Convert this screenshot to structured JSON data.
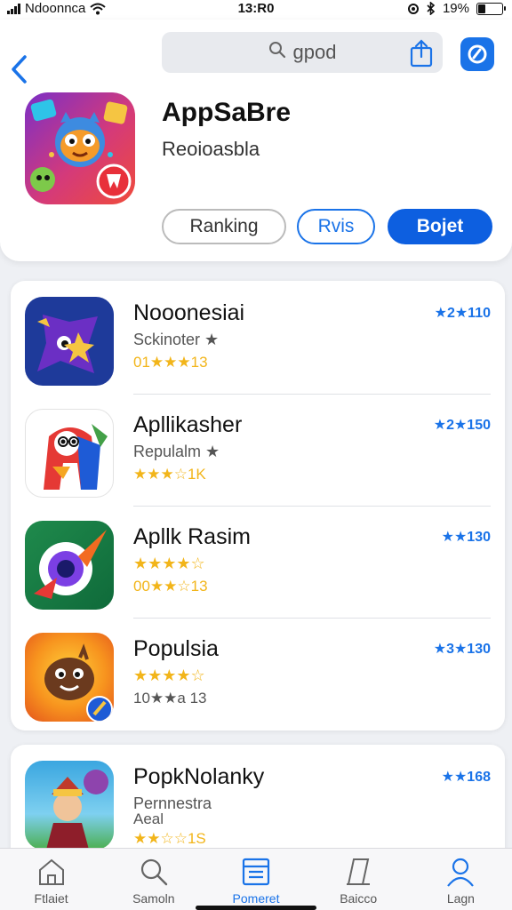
{
  "status_bar": {
    "carrier": "Ndoonnca",
    "time": "13:R0",
    "battery": "19%"
  },
  "header": {
    "search_text": "gpod",
    "app_title": "AppSaBre",
    "app_subtitle": "Reoioasbla",
    "buttons": {
      "ranking": "Ranking",
      "rvis": "Rvis",
      "get": "Bojet"
    }
  },
  "list": [
    {
      "name": "Nooonesiai",
      "subtitle": "Sckinoter ★",
      "meta": "01★★★13",
      "rank": "★2★110",
      "stars": null
    },
    {
      "name": "Apllikasher",
      "subtitle": "Repulalm ★",
      "meta": "★★★☆1K",
      "rank": "★2★150",
      "stars": null
    },
    {
      "name": "Apllk Rasim",
      "subtitle": "★★★★☆",
      "meta": "00★★☆13",
      "rank": "★★130",
      "stars": null
    },
    {
      "name": "Populsia",
      "subtitle": "★★★★☆",
      "meta": "10★★a 13",
      "rank": "★3★130",
      "stars": null
    }
  ],
  "list2": [
    {
      "name": "PopkNolanky",
      "subtitle": "Pernnestra",
      "subtitle2": "Aeal",
      "meta": "★★☆☆1S",
      "rank": "★★168"
    }
  ],
  "tabs": [
    {
      "label": "Ftlaiet",
      "icon": "home-icon"
    },
    {
      "label": "Samoln",
      "icon": "search-icon"
    },
    {
      "label": "Pomeret",
      "icon": "apps-icon"
    },
    {
      "label": "Baicco",
      "icon": "arcade-icon"
    },
    {
      "label": "Lagn",
      "icon": "profile-icon"
    }
  ],
  "colors": {
    "accent": "#1a73e8",
    "get_button": "#0d5fe0",
    "star": "#f2b51a"
  }
}
